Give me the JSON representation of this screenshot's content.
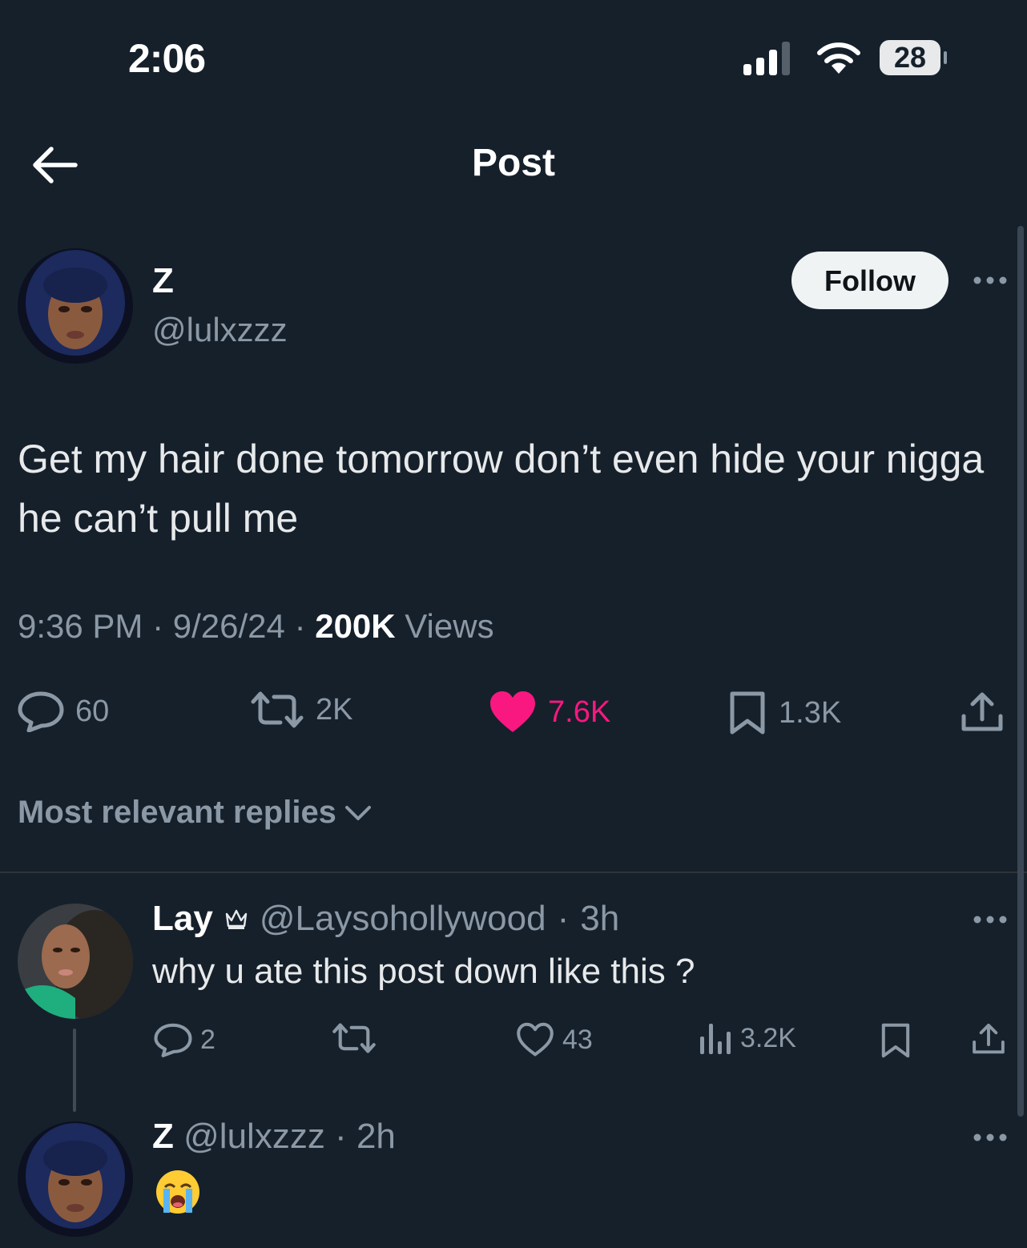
{
  "status_bar": {
    "time": "2:06",
    "battery": "28"
  },
  "header": {
    "title": "Post"
  },
  "post": {
    "author_name": "Z",
    "author_handle": "@lulxzzz",
    "follow_label": "Follow",
    "text": "Get my hair done tomorrow don’t even hide your nigga he can’t pull me",
    "time": "9:36 PM",
    "date": "9/26/24",
    "views_count": "200K",
    "views_label": "Views",
    "replies": "60",
    "reposts": "2K",
    "likes": "7.6K",
    "bookmarks": "1.3K"
  },
  "colors": {
    "background": "#15202b",
    "like": "#f91880",
    "muted": "#8b98a5",
    "text": "#e7e9ea"
  },
  "sort_label": "Most relevant replies",
  "replies": [
    {
      "name": "Lay",
      "badge_icon": "crown-icon",
      "handle": "@Laysohollywood",
      "age": "3h",
      "text": "why u ate this post down like this ?",
      "replies": "2",
      "likes": "43",
      "views": "3.2K"
    },
    {
      "name": "Z",
      "handle": "@lulxzzz",
      "age": "2h",
      "emoji_icon": "loudly-crying-face-icon"
    }
  ]
}
